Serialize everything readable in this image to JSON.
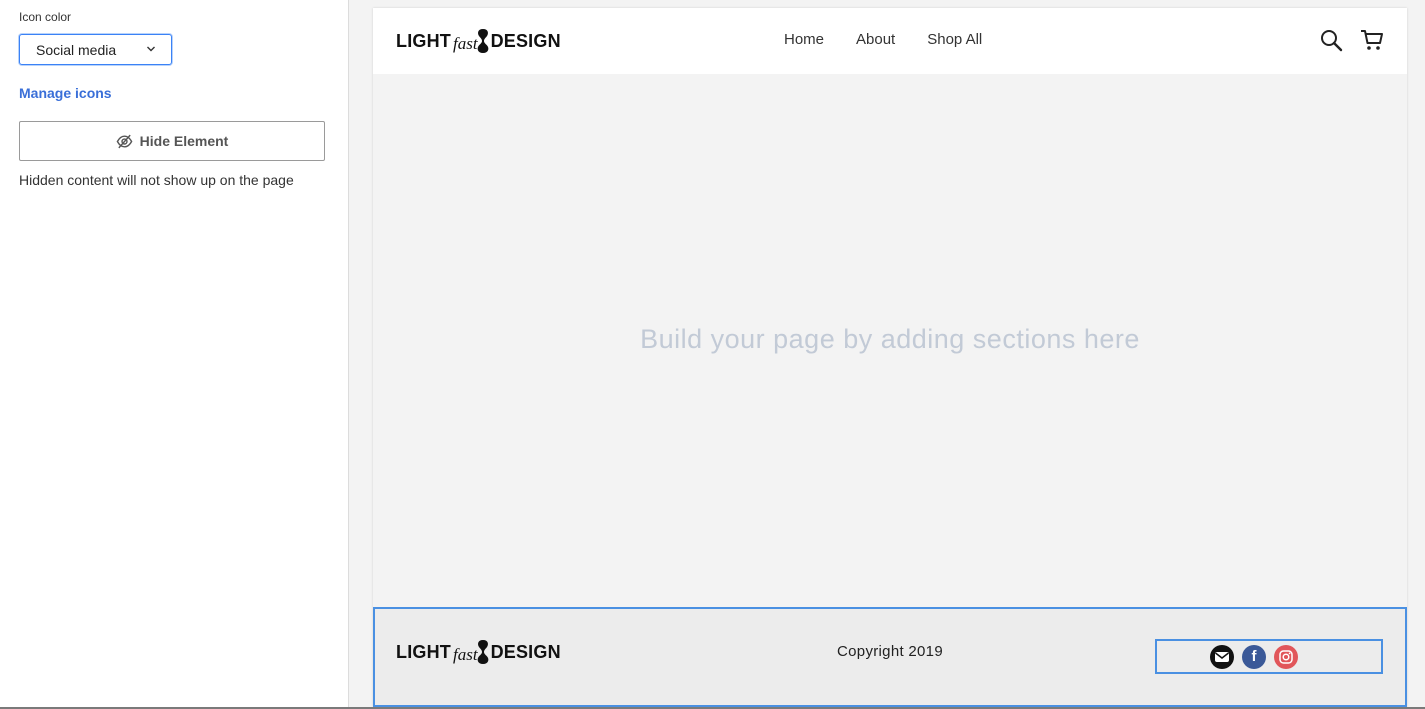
{
  "sidebar": {
    "icon_color_label": "Icon color",
    "icon_color_value": "Social media",
    "manage_link": "Manage icons",
    "hide_button": "Hide Element",
    "hint": "Hidden content will not show up on the page"
  },
  "header": {
    "logo": {
      "left": "LIGHT",
      "middle": "fast",
      "right": "DESIGN"
    },
    "nav": [
      "Home",
      "About",
      "Shop All"
    ],
    "icons": [
      "search-icon",
      "cart-icon"
    ]
  },
  "main": {
    "placeholder": "Build your page by adding sections here"
  },
  "footer": {
    "logo": {
      "left": "LIGHT",
      "middle": "fast",
      "right": "DESIGN"
    },
    "copyright": "Copyright 2019",
    "social_icons": [
      "email-icon",
      "facebook-icon",
      "instagram-icon"
    ]
  },
  "colors": {
    "accent": "#3a6fd8",
    "selection": "#4a90e2",
    "facebook": "#3b5998",
    "instagram": "#e1565a",
    "placeholder_text": "#c2cad6"
  }
}
